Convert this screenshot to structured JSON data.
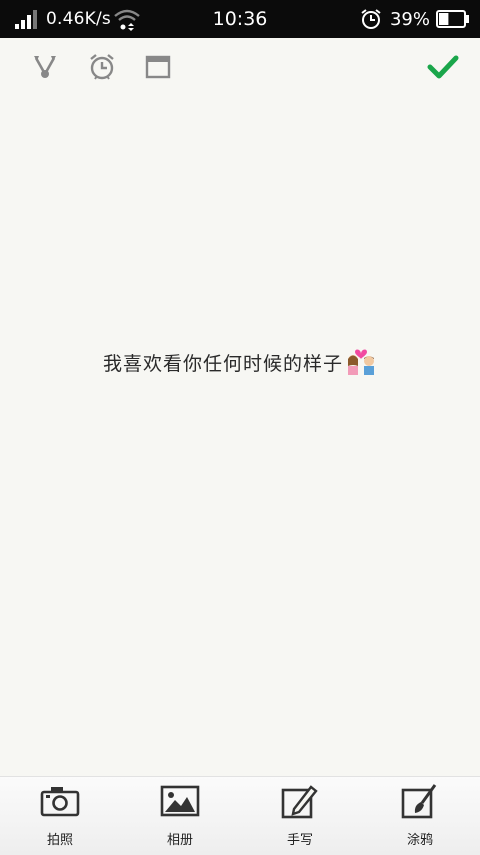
{
  "status_bar": {
    "net_speed": "0.46K/s",
    "time": "10:36",
    "battery": "39%",
    "battery_level": 0.39
  },
  "toolbar": {
    "icons": [
      "share-icon",
      "alarm-icon",
      "window-icon"
    ],
    "confirm_icon": "checkmark-icon",
    "confirm_color": "#1aa64a"
  },
  "note": {
    "text": "我喜欢看你任何时候的样子",
    "emoji": "couple-with-heart-icon"
  },
  "bottom_bar": {
    "items": [
      {
        "label": "拍照",
        "icon": "camera-icon"
      },
      {
        "label": "相册",
        "icon": "photo-album-icon"
      },
      {
        "label": "手写",
        "icon": "handwriting-icon"
      },
      {
        "label": "涂鸦",
        "icon": "brush-icon"
      }
    ]
  }
}
